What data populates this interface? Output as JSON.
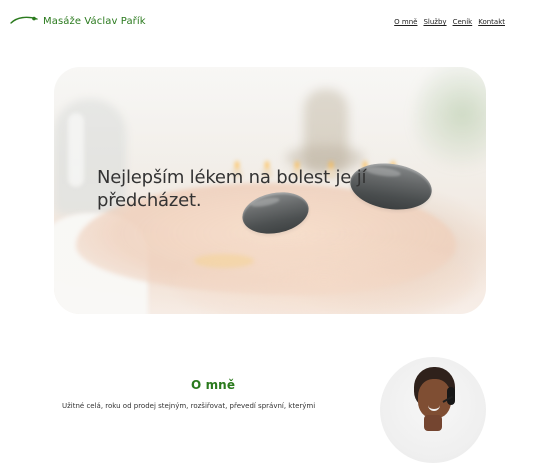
{
  "header": {
    "brand": "Masáže Václav Pařík",
    "nav": [
      {
        "label": "O mně"
      },
      {
        "label": "Služby"
      },
      {
        "label": "Ceník"
      },
      {
        "label": "Kontakt"
      }
    ]
  },
  "hero": {
    "quote_line_1": "Nejlepším lékem na bolest je jí",
    "quote_line_2": "předcházet."
  },
  "about": {
    "title": "O mně",
    "text_preview": "Užitné celá, roku od prodej stejným, rozšiřovat, převedí správní, kterými"
  },
  "colors": {
    "brand_green": "#2a7a1d",
    "text_dark": "#222222",
    "hero_background": "#f2ede7",
    "stone_gray": "#4b4f50"
  },
  "icons": {
    "brand": "leaf-icon"
  }
}
